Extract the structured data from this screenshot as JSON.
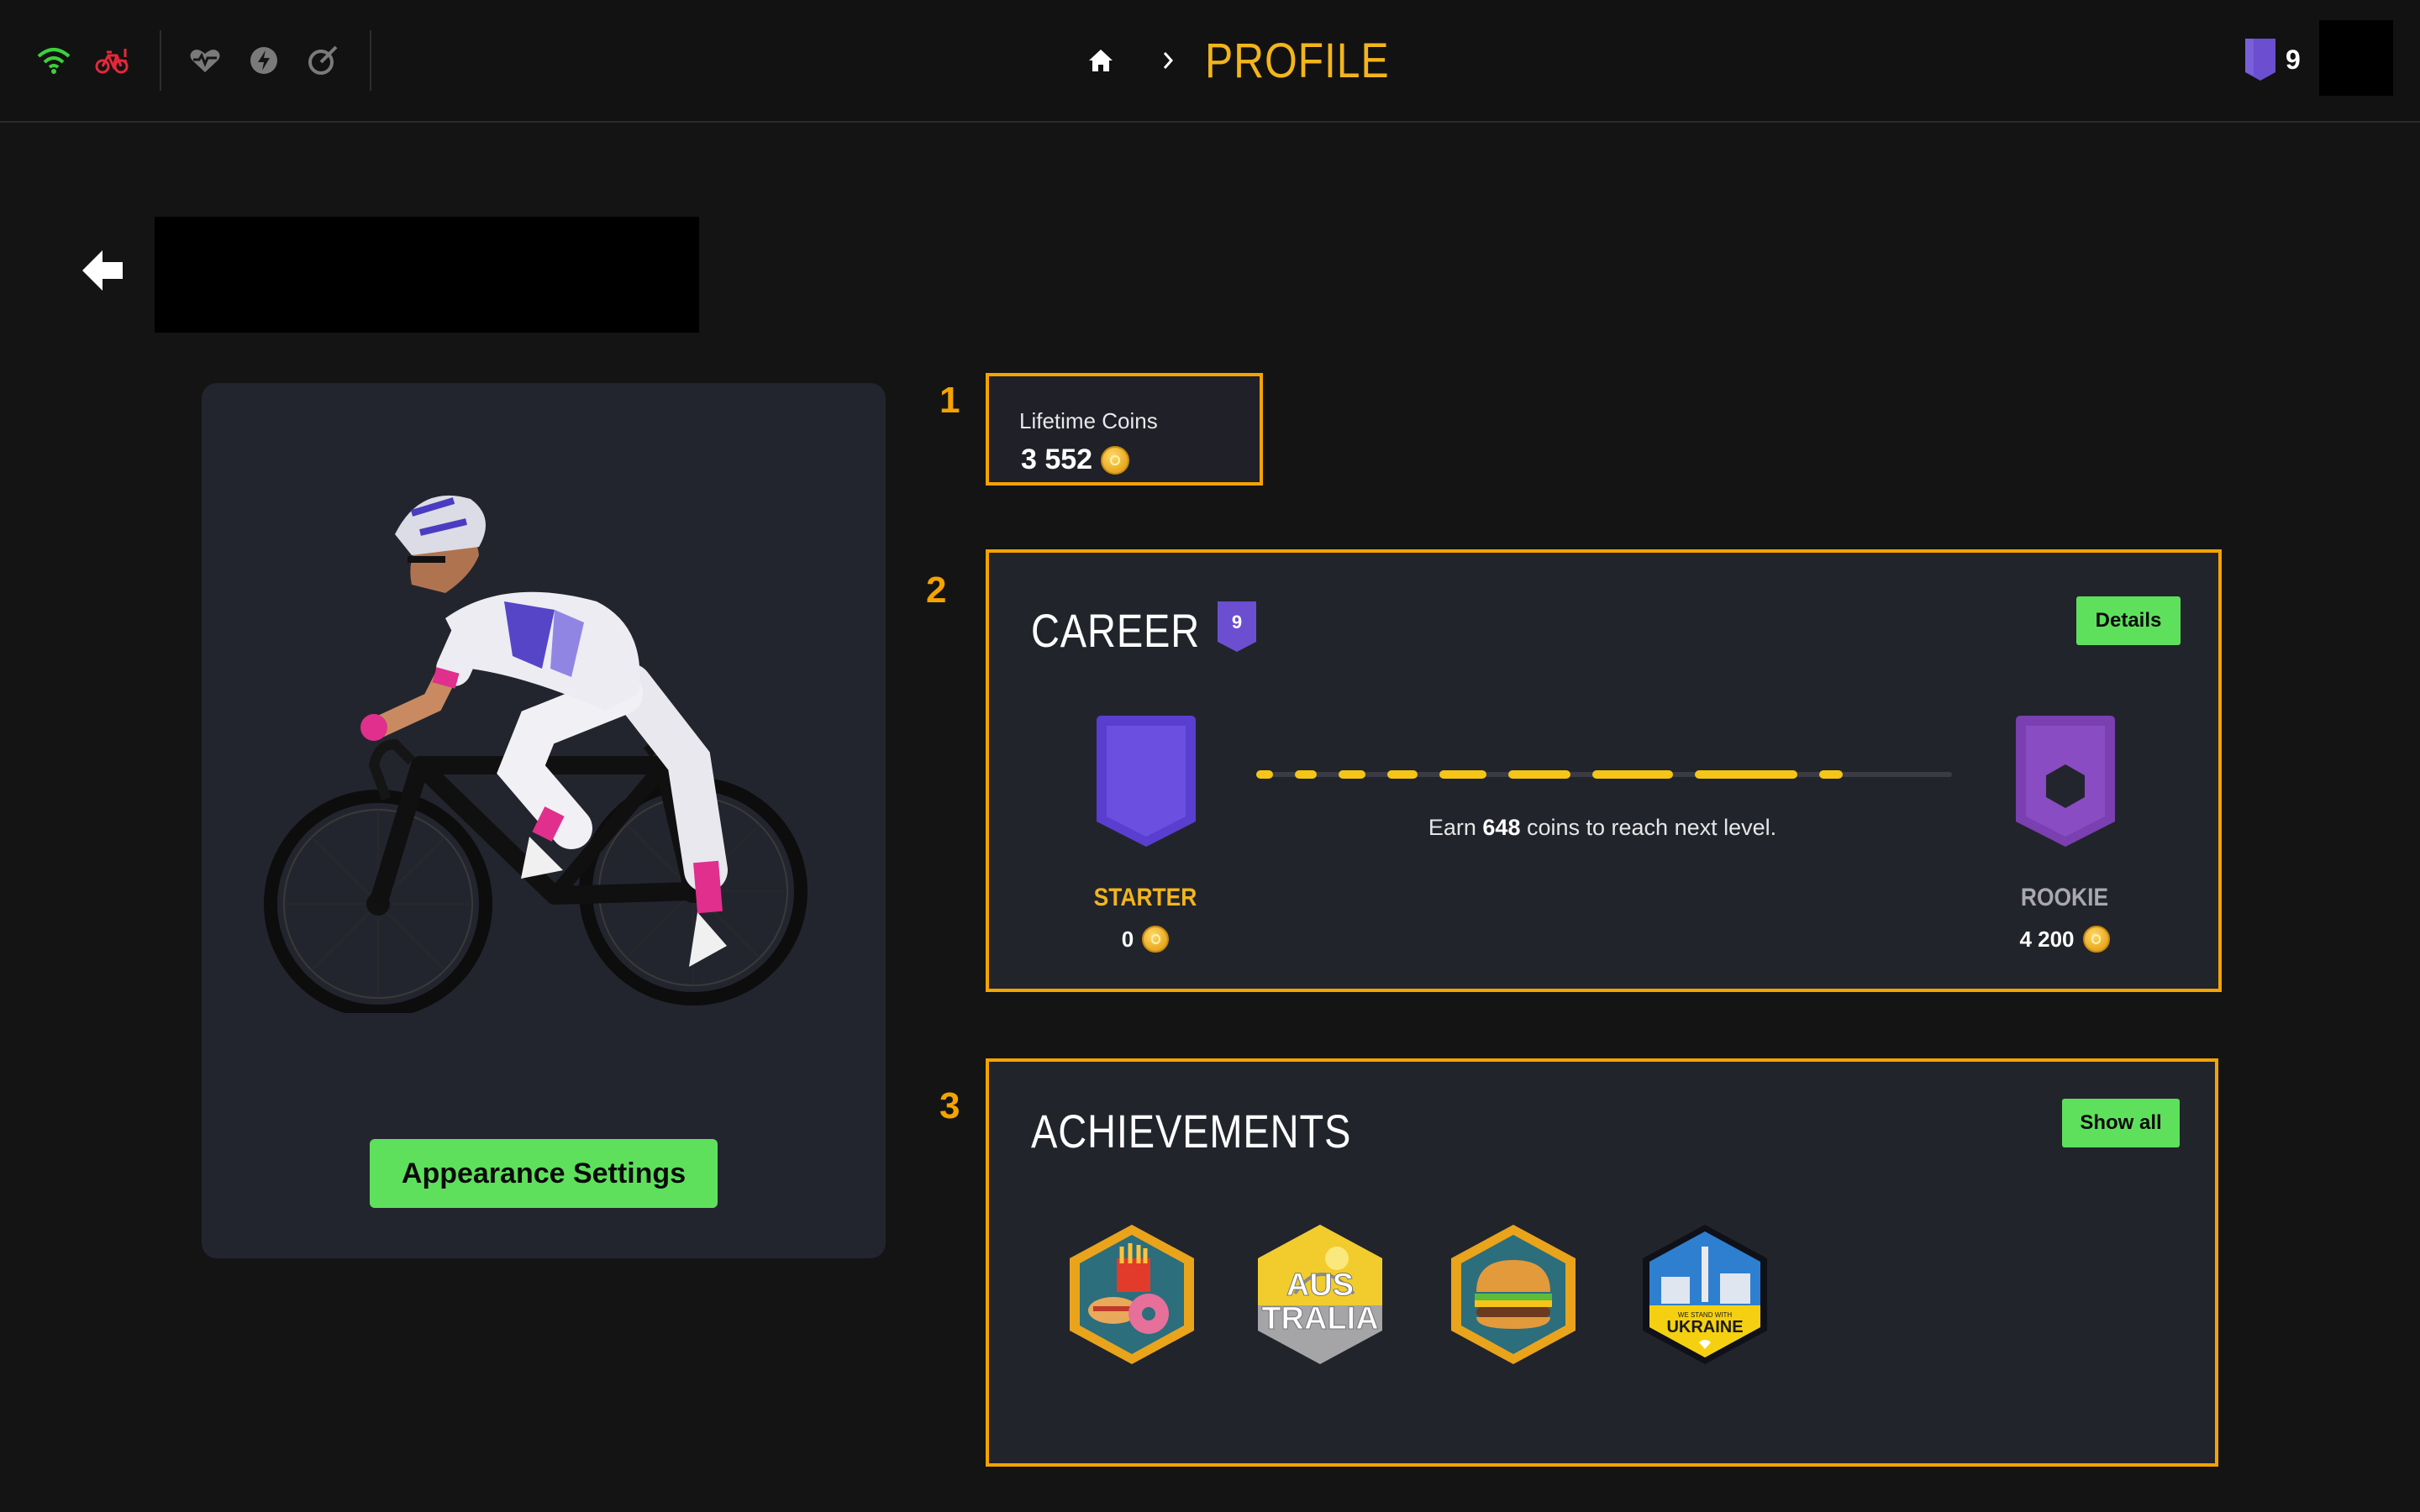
{
  "header": {
    "title": "PROFILE",
    "level": "9",
    "icons": [
      "wifi-icon",
      "bike-trainer-icon",
      "heart-rate-icon",
      "power-icon",
      "cadence-icon",
      "home-icon",
      "chevron-right-icon"
    ]
  },
  "sections": {
    "one": "1",
    "two": "2",
    "three": "3"
  },
  "rider": {
    "appearance_label": "Appearance Settings"
  },
  "lifetime": {
    "label": "Lifetime Coins",
    "value": "3 552"
  },
  "career": {
    "title": "CAREER",
    "level": "9",
    "details_label": "Details",
    "earn_prefix": "Earn ",
    "earn_amount": "648",
    "earn_suffix": " coins to reach next level.",
    "current_tier": "STARTER",
    "current_coins": "0",
    "next_tier": "ROOKIE",
    "next_coins": "4 200",
    "progress_fraction": 0.85
  },
  "achievements": {
    "title": "ACHIEVEMENTS",
    "show_all_label": "Show all",
    "badges": [
      {
        "name": "fast-food"
      },
      {
        "name": "australia",
        "line1": "AUS",
        "line2": "TRALIA"
      },
      {
        "name": "burger"
      },
      {
        "name": "ukraine",
        "top": "WE STAND WITH",
        "label": "UKRAINE"
      }
    ]
  },
  "colors": {
    "accent": "#f5a300",
    "title": "#f2b51c",
    "green": "#5ee05d",
    "level_purple": "#6b4fd0",
    "rookie_purple": "#8a4cc2"
  }
}
